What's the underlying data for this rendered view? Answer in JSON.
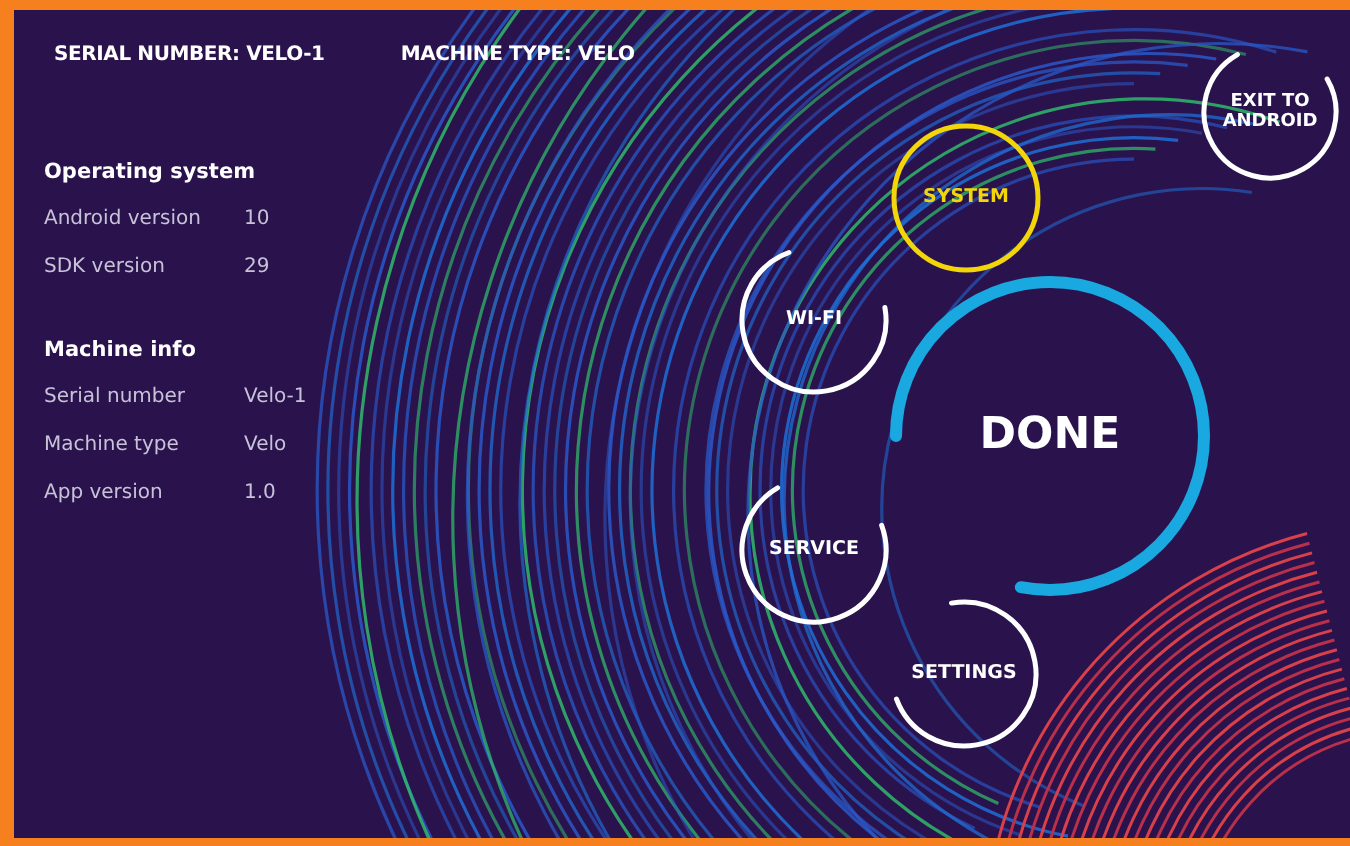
{
  "header": [
    {
      "label": "SERIAL NUMBER: VELO-1"
    },
    {
      "label": "MACHINE TYPE: VELO"
    }
  ],
  "sections": [
    {
      "title": "Operating system",
      "rows": [
        {
          "label": "Android version",
          "value": "10"
        },
        {
          "label": "SDK version",
          "value": "29"
        }
      ]
    },
    {
      "title": "Machine info",
      "rows": [
        {
          "label": "Serial number",
          "value": "Velo-1"
        },
        {
          "label": "Machine type",
          "value": "Velo"
        },
        {
          "label": "App version",
          "value": "1.0"
        }
      ]
    }
  ],
  "menu": [
    {
      "label": "SYSTEM",
      "selected": true
    },
    {
      "label": "WI-FI",
      "selected": false
    },
    {
      "label": "SERVICE",
      "selected": false
    },
    {
      "label": "SETTINGS",
      "selected": false
    }
  ],
  "done_button": {
    "label": "DONE"
  },
  "exit_button": {
    "label": "EXIT TO ANDROID"
  }
}
